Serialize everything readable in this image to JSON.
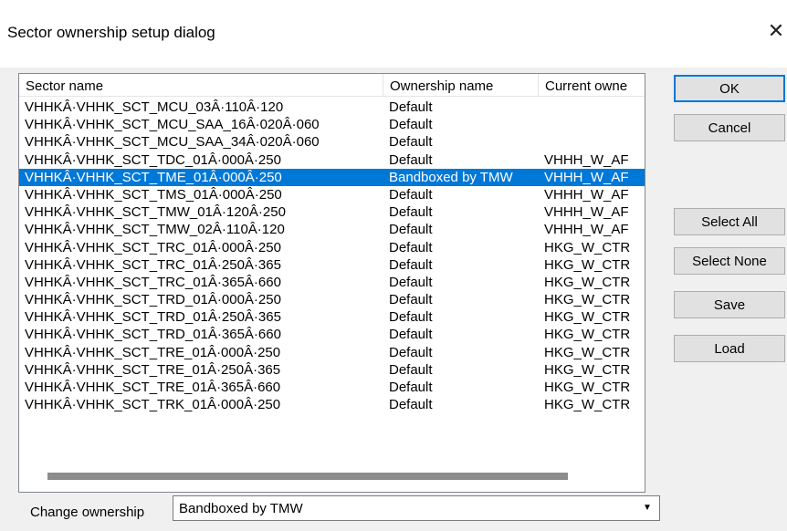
{
  "window": {
    "title": "Sector ownership setup dialog",
    "close_glyph": "✕"
  },
  "list": {
    "columns": [
      "Sector name",
      "Ownership name",
      "Current owne"
    ],
    "rows": [
      [
        "VHHKÂ·VHHK_SCT_MCU_03Â·110Â·120",
        "Default",
        ""
      ],
      [
        "VHHKÂ·VHHK_SCT_MCU_SAA_16Â·020Â·060",
        "Default",
        ""
      ],
      [
        "VHHKÂ·VHHK_SCT_MCU_SAA_34Â·020Â·060",
        "Default",
        ""
      ],
      [
        "VHHKÂ·VHHK_SCT_TDC_01Â·000Â·250",
        "Default",
        "VHHH_W_AF"
      ],
      [
        "VHHKÂ·VHHK_SCT_TME_01Â·000Â·250",
        "Bandboxed by TMW",
        "VHHH_W_AF"
      ],
      [
        "VHHKÂ·VHHK_SCT_TMS_01Â·000Â·250",
        "Default",
        "VHHH_W_AF"
      ],
      [
        "VHHKÂ·VHHK_SCT_TMW_01Â·120Â·250",
        "Default",
        "VHHH_W_AF"
      ],
      [
        "VHHKÂ·VHHK_SCT_TMW_02Â·110Â·120",
        "Default",
        "VHHH_W_AF"
      ],
      [
        "VHHKÂ·VHHK_SCT_TRC_01Â·000Â·250",
        "Default",
        "HKG_W_CTR"
      ],
      [
        "VHHKÂ·VHHK_SCT_TRC_01Â·250Â·365",
        "Default",
        "HKG_W_CTR"
      ],
      [
        "VHHKÂ·VHHK_SCT_TRC_01Â·365Â·660",
        "Default",
        "HKG_W_CTR"
      ],
      [
        "VHHKÂ·VHHK_SCT_TRD_01Â·000Â·250",
        "Default",
        "HKG_W_CTR"
      ],
      [
        "VHHKÂ·VHHK_SCT_TRD_01Â·250Â·365",
        "Default",
        "HKG_W_CTR"
      ],
      [
        "VHHKÂ·VHHK_SCT_TRD_01Â·365Â·660",
        "Default",
        "HKG_W_CTR"
      ],
      [
        "VHHKÂ·VHHK_SCT_TRE_01Â·000Â·250",
        "Default",
        "HKG_W_CTR"
      ],
      [
        "VHHKÂ·VHHK_SCT_TRE_01Â·250Â·365",
        "Default",
        "HKG_W_CTR"
      ],
      [
        "VHHKÂ·VHHK_SCT_TRE_01Â·365Â·660",
        "Default",
        "HKG_W_CTR"
      ],
      [
        "VHHKÂ·VHHK_SCT_TRK_01Â·000Â·250",
        "Default",
        "HKG_W_CTR"
      ]
    ],
    "selected_index": 4
  },
  "buttons": {
    "ok": "OK",
    "cancel": "Cancel",
    "select_all": "Select All",
    "select_none": "Select None",
    "save": "Save",
    "load": "Load"
  },
  "change_ownership": {
    "label": "Change ownership",
    "value": "Bandboxed by TMW",
    "dropdown_glyph": "▼"
  },
  "colors": {
    "selection": "#0078d7",
    "default_button_border": "#0078d7"
  }
}
